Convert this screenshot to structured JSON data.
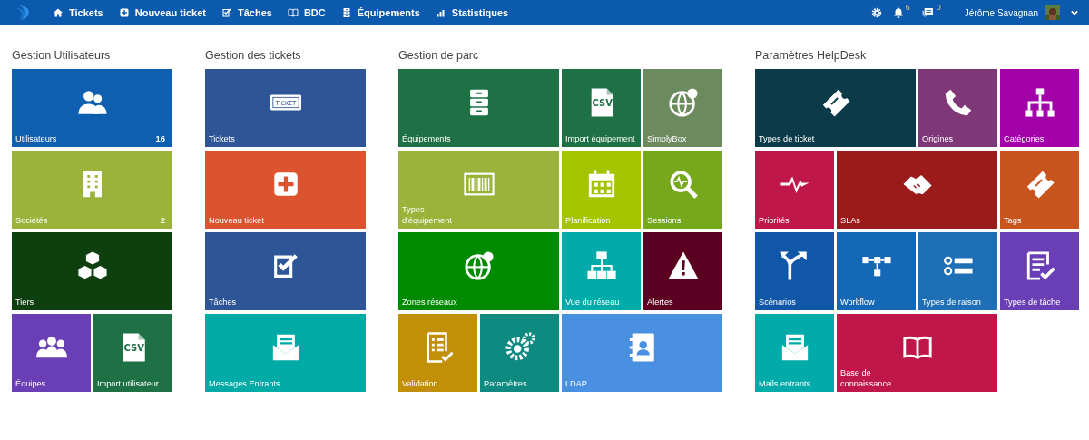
{
  "nav": {
    "items": [
      {
        "label": "Tickets"
      },
      {
        "label": "Nouveau ticket"
      },
      {
        "label": "Tâches"
      },
      {
        "label": "BDC"
      },
      {
        "label": "Équipements"
      },
      {
        "label": "Statistiques"
      }
    ],
    "notifications": "6",
    "messages": "0",
    "user": "Jérôme Savagnan"
  },
  "groups": [
    {
      "title": "Gestion Utilisateurs",
      "tiles": [
        {
          "label": "Utilisateurs",
          "count": "16",
          "kind": "wide",
          "color": "#0f5fb0"
        },
        {
          "label": "Sociétés",
          "count": "2",
          "kind": "wide",
          "color": "#9bb33a"
        },
        {
          "label": "Tiers",
          "kind": "wide",
          "color": "#0d3f0f"
        },
        {
          "label": "Équipes",
          "kind": "small",
          "color": "#6a3fb6"
        },
        {
          "label": "Import utilisateur",
          "kind": "small",
          "color": "#1e7145",
          "icon_text": "CSV"
        }
      ]
    },
    {
      "title": "Gestion des tickets",
      "tiles": [
        {
          "label": "Tickets",
          "kind": "wide",
          "color": "#2d5597",
          "icon_text": "TICKET"
        },
        {
          "label": "Nouveau ticket",
          "kind": "wide",
          "color": "#dc5330"
        },
        {
          "label": "Tâches",
          "kind": "wide",
          "color": "#2d5597"
        },
        {
          "label": "Messages Entrants",
          "kind": "wide",
          "color": "#00aaa6"
        }
      ]
    },
    {
      "title": "Gestion de parc",
      "tiles": [
        {
          "label": "Équipements",
          "kind": "wide",
          "color": "#1e7145"
        },
        {
          "label": "Import équipement",
          "kind": "small",
          "color": "#1e7145",
          "icon_text": "CSV"
        },
        {
          "label": "SimplyBox",
          "kind": "small",
          "color": "#6b8a5e"
        },
        {
          "label": "Types d'équipement",
          "kind": "wide",
          "color": "#9bb33a"
        },
        {
          "label": "Planification",
          "kind": "small",
          "color": "#a4c400"
        },
        {
          "label": "Sessions",
          "kind": "small",
          "color": "#76a81c"
        },
        {
          "label": "Zones réseaux",
          "kind": "wide",
          "color": "#008a00"
        },
        {
          "label": "Vue du réseau",
          "kind": "small",
          "color": "#00aba9"
        },
        {
          "label": "Alertes",
          "kind": "small",
          "color": "#5c0021"
        },
        {
          "label": "Validation",
          "kind": "small",
          "color": "#c18f08"
        },
        {
          "label": "Paramètres",
          "kind": "small",
          "color": "#0f8a80"
        },
        {
          "label": "LDAP",
          "kind": "wide",
          "color": "#4a90e2"
        }
      ]
    },
    {
      "title": "Paramètres HelpDesk",
      "tiles": [
        {
          "label": "Types de ticket",
          "kind": "wide",
          "color": "#0b3b48"
        },
        {
          "label": "Origines",
          "kind": "small",
          "color": "#7e3878"
        },
        {
          "label": "Catégories",
          "kind": "small",
          "color": "#a200a8"
        },
        {
          "label": "Priorités",
          "kind": "small",
          "color": "#c0174b"
        },
        {
          "label": "SLAs",
          "kind": "wide",
          "color": "#9b1a1a"
        },
        {
          "label": "Tags",
          "kind": "small",
          "color": "#c8541e"
        },
        {
          "label": "Scénarios",
          "kind": "small",
          "color": "#1157a7"
        },
        {
          "label": "Workflow",
          "kind": "small",
          "color": "#1568b5"
        },
        {
          "label": "Types de raison",
          "kind": "small",
          "color": "#1e6fb5"
        },
        {
          "label": "Types de tâche",
          "kind": "small",
          "color": "#6a3fb6"
        },
        {
          "label": "Mails entrants",
          "kind": "small",
          "color": "#00aba9"
        },
        {
          "label": "Base de connaissance",
          "kind": "wide",
          "color": "#c0174b"
        }
      ]
    }
  ]
}
